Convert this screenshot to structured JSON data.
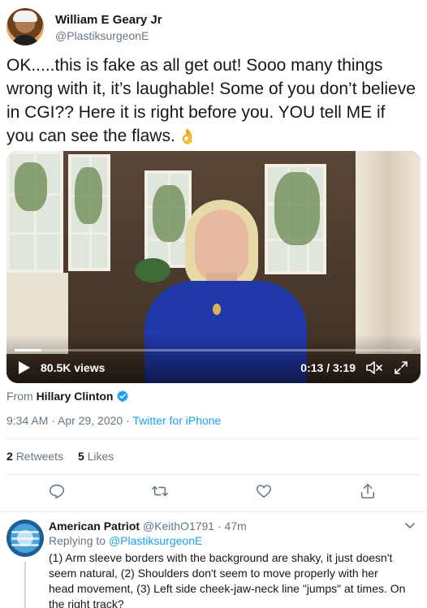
{
  "author": {
    "name": "William E Geary Jr",
    "handle": "@PlastiksurgeonE"
  },
  "tweet": {
    "text": "OK.....this is fake as all get out! Sooo many things wrong with it, it’s laughable! Some of you don’t believe in CGI?? Here it is right before you. YOU tell ME if you can see the flaws.",
    "emoji": "👌"
  },
  "video": {
    "views": "80.5K views",
    "time": "0:13 / 3:19",
    "progress_fraction": 0.068
  },
  "source": {
    "prefix": "From",
    "name": "Hillary Clinton"
  },
  "meta": {
    "timestamp": "9:34 AM · Apr 29, 2020 · ",
    "client": "Twitter for iPhone"
  },
  "stats": {
    "retweets_count": "2",
    "retweets_label": "Retweets",
    "likes_count": "5",
    "likes_label": "Likes"
  },
  "reply": {
    "name": "American Patriot",
    "handle": "@KeithO1791",
    "age": "· 47m",
    "replying_prefix": "Replying to",
    "replying_to": "@PlastiksurgeonE",
    "text": "(1) Arm sleeve borders with the background are shaky, it just doesn't seem natural, (2) Shoulders don't seem to move properly with her head movement, (3) Left side cheek-jaw-neck line \"jumps\" at times.  On the right track?"
  },
  "colors": {
    "link": "#1da1f2",
    "secondary_text": "#657786",
    "primary_text": "#14171a",
    "verified": "#1da1f2"
  }
}
